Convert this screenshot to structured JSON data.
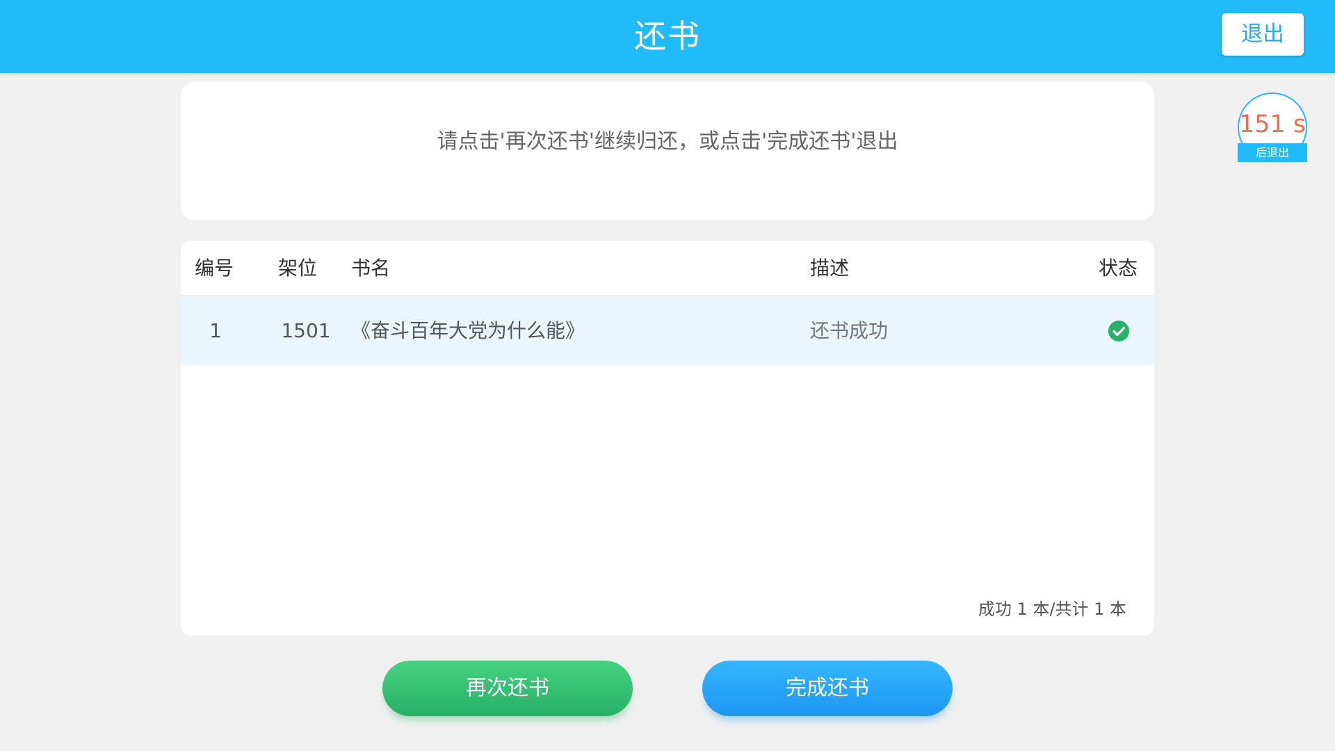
{
  "header": {
    "title": "还书",
    "exit_label": "退出"
  },
  "countdown": {
    "value": "151 s",
    "label": "后退出",
    "value_color": "#f26b4d",
    "ring_color": "#22bbf9"
  },
  "message": {
    "text": "请点击'再次还书'继续归还，或点击'完成还书'退出"
  },
  "table": {
    "columns": {
      "id": "编号",
      "shelf": "架位",
      "title": "书名",
      "description": "描述",
      "status": "状态"
    },
    "rows": [
      {
        "id": "1",
        "shelf": "1501",
        "title": "《奋斗百年大党为什么能》",
        "description": "还书成功",
        "status_icon": "check-circle-icon",
        "status_color": "#27b067"
      }
    ],
    "summary": "成功 1 本/共计 1 本"
  },
  "actions": {
    "again_label": "再次还书",
    "finish_label": "完成还书"
  },
  "colors": {
    "accent": "#22bbf9",
    "success": "#27b067",
    "primary_button": "#1d96f4"
  }
}
